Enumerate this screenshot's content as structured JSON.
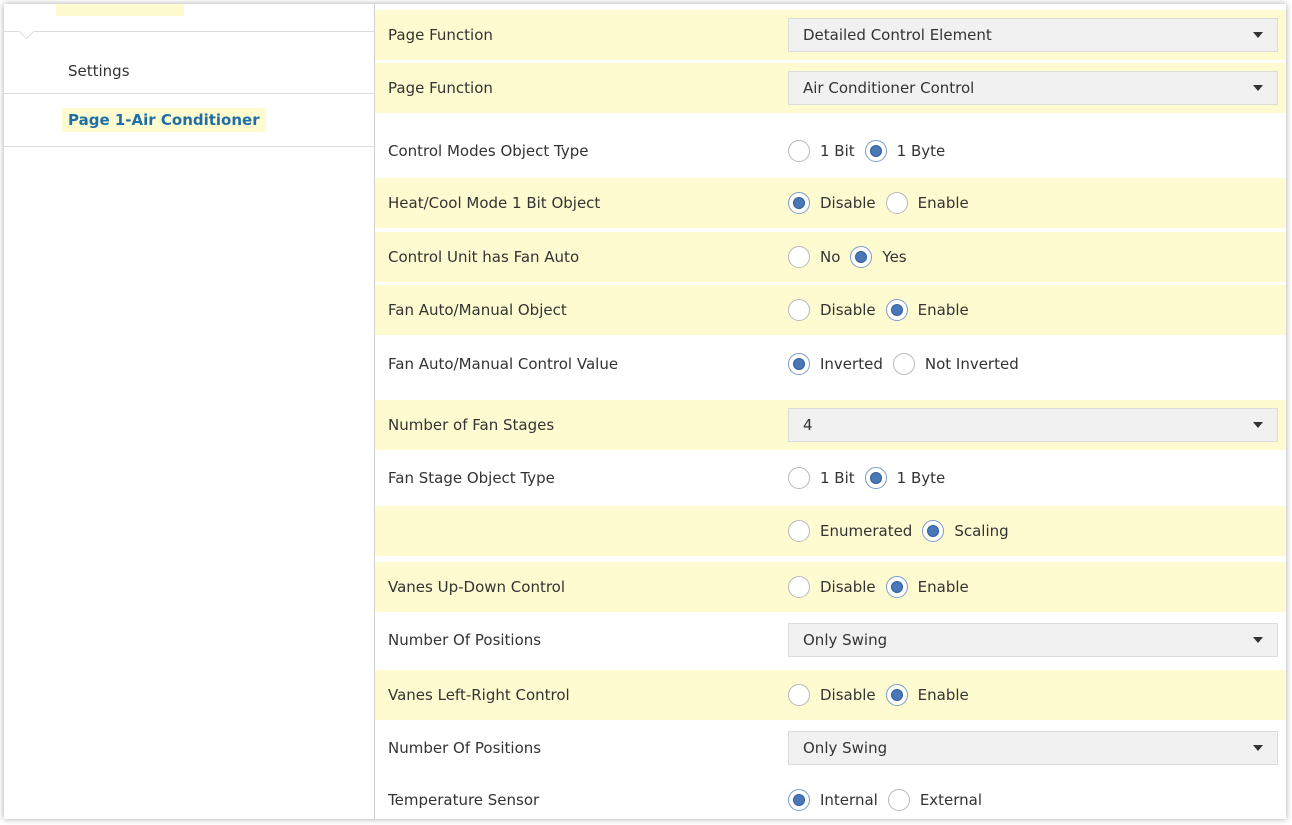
{
  "sidebar": {
    "items": [
      {
        "label": "Settings"
      },
      {
        "label": "Page 1-Air Conditioner"
      }
    ]
  },
  "rows": [
    {
      "label": "Page Function",
      "type": "dropdown",
      "value": "Detailed Control Element",
      "highlight": true
    },
    {
      "label": "Page Function",
      "type": "dropdown",
      "value": "Air Conditioner Control",
      "highlight": true
    },
    {
      "label": "Control Modes Object Type",
      "type": "radio",
      "options": [
        "1 Bit",
        "1 Byte"
      ],
      "selected": 1,
      "highlight": false
    },
    {
      "label": "Heat/Cool Mode 1 Bit Object",
      "type": "radio",
      "options": [
        "Disable",
        "Enable"
      ],
      "selected": 0,
      "highlight": true
    },
    {
      "label": "Control Unit has Fan Auto",
      "type": "radio",
      "options": [
        "No",
        "Yes"
      ],
      "selected": 1,
      "highlight": true
    },
    {
      "label": "Fan Auto/Manual Object",
      "type": "radio",
      "options": [
        "Disable",
        "Enable"
      ],
      "selected": 1,
      "highlight": true
    },
    {
      "label": "Fan Auto/Manual Control Value",
      "type": "radio",
      "options": [
        "Inverted",
        "Not Inverted"
      ],
      "selected": 0,
      "highlight": false
    },
    {
      "label": "Number of Fan Stages",
      "type": "dropdown",
      "value": "4",
      "highlight": true
    },
    {
      "label": "Fan Stage Object Type",
      "type": "radio",
      "options": [
        "1 Bit",
        "1 Byte"
      ],
      "selected": 1,
      "highlight": false
    },
    {
      "label": "",
      "type": "radio",
      "options": [
        "Enumerated",
        "Scaling"
      ],
      "selected": 1,
      "highlight": true
    },
    {
      "label": "Vanes Up-Down Control",
      "type": "radio",
      "options": [
        "Disable",
        "Enable"
      ],
      "selected": 1,
      "highlight": true
    },
    {
      "label": "Number Of Positions",
      "type": "dropdown",
      "value": "Only Swing",
      "highlight": false
    },
    {
      "label": "Vanes Left-Right Control",
      "type": "radio",
      "options": [
        "Disable",
        "Enable"
      ],
      "selected": 1,
      "highlight": true
    },
    {
      "label": "Number Of Positions",
      "type": "dropdown",
      "value": "Only Swing",
      "highlight": false
    },
    {
      "label": "Temperature Sensor",
      "type": "radio",
      "options": [
        "Internal",
        "External"
      ],
      "selected": 0,
      "highlight": false
    }
  ]
}
